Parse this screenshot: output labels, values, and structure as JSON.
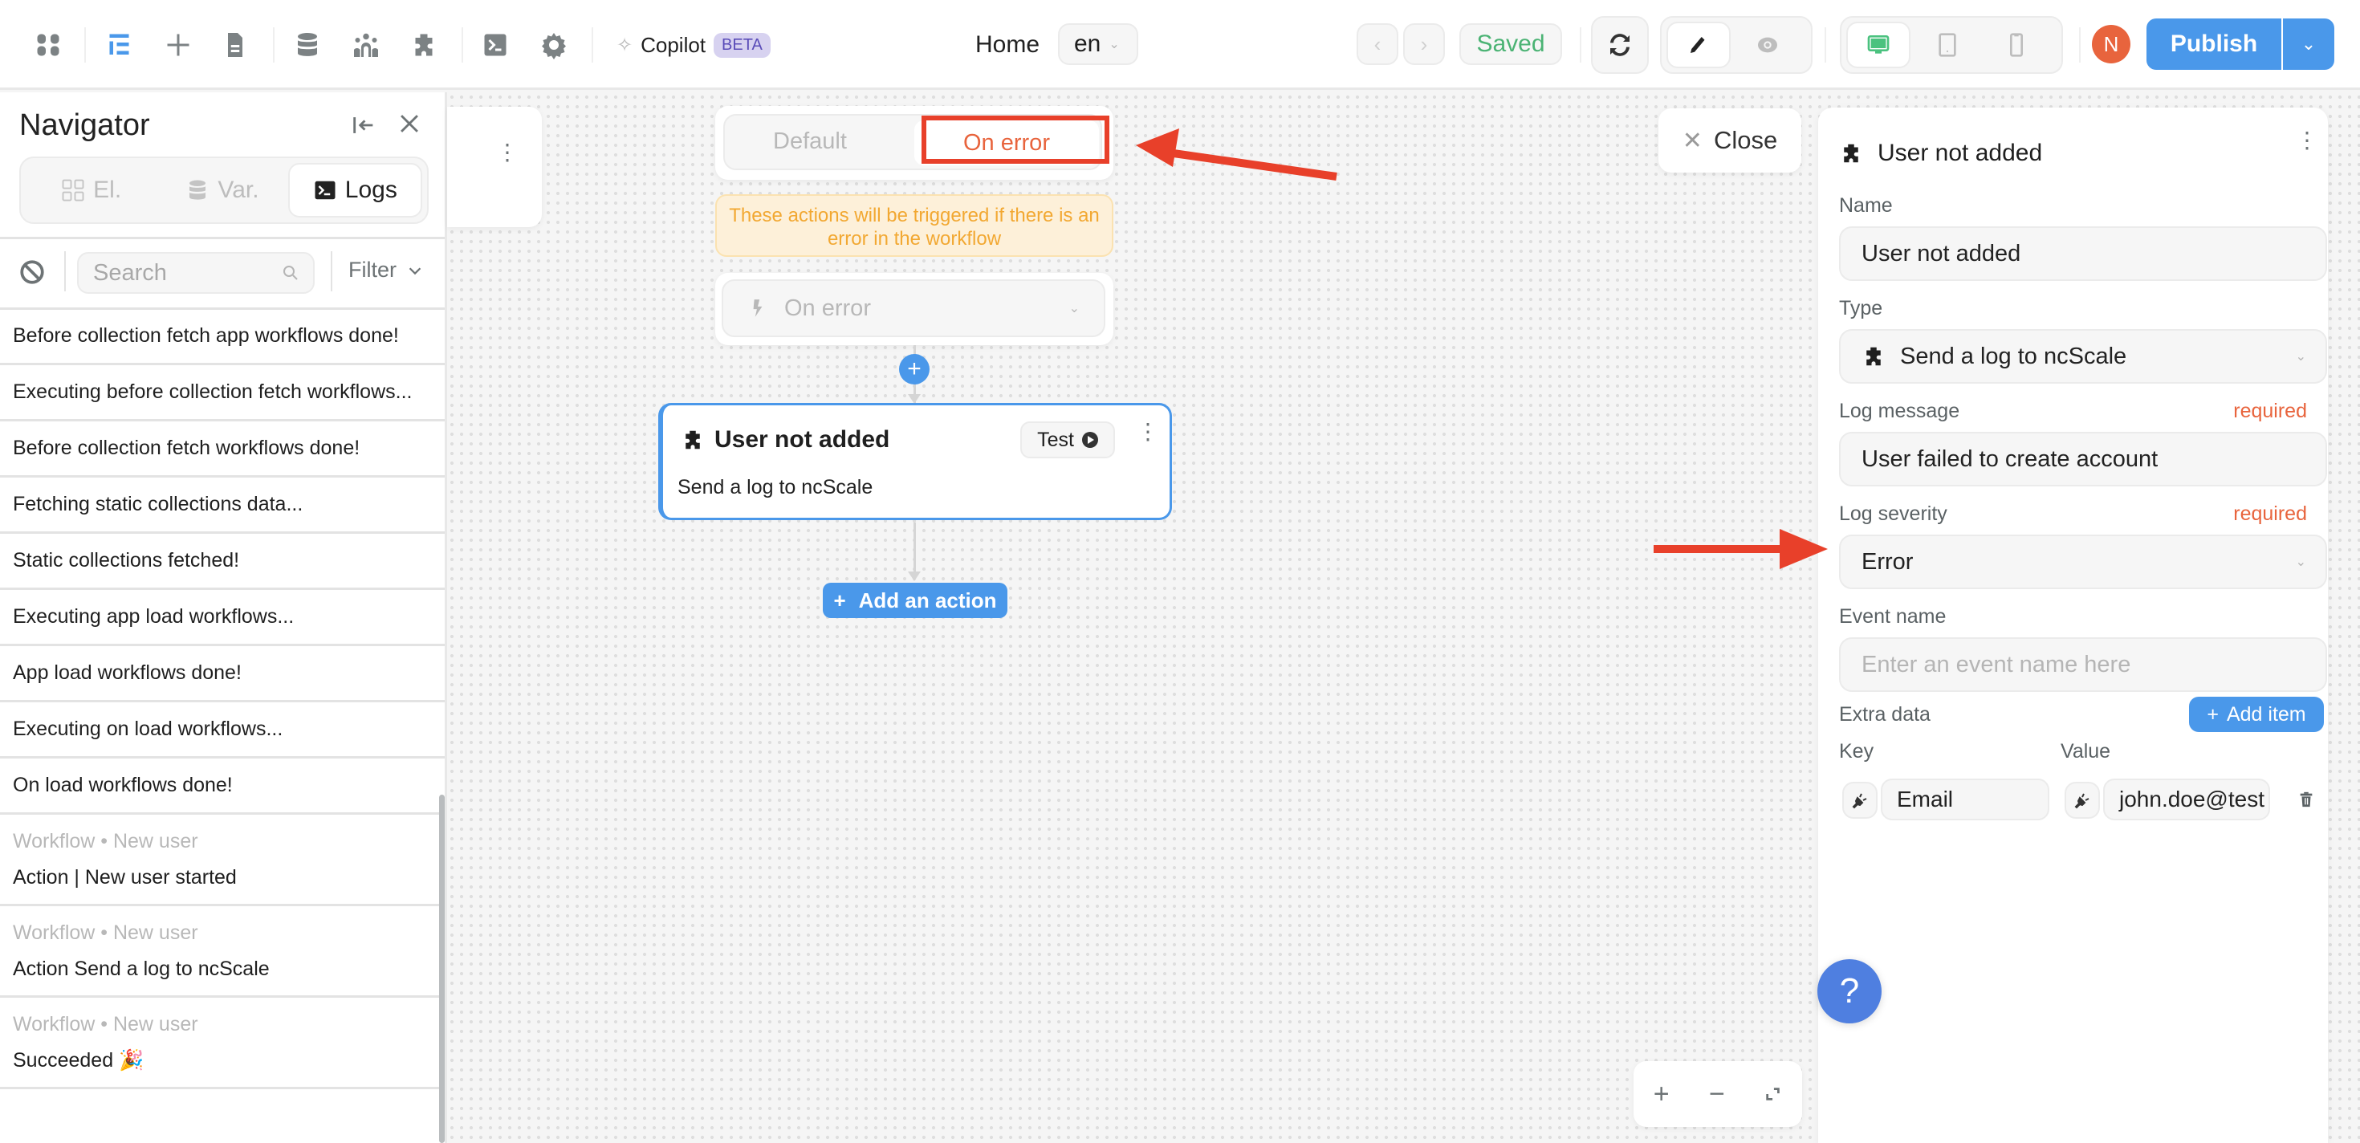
{
  "topbar": {
    "icons": [
      "apps-icon",
      "layers-icon",
      "add-icon",
      "page-icon",
      "database-icon",
      "users-icon",
      "plugin-icon",
      "terminal-icon",
      "gear-icon"
    ],
    "copilot_label": "Copilot",
    "beta_badge": "BETA",
    "page_name": "Home",
    "language": "en",
    "save_status": "Saved",
    "avatar_initial": "N",
    "publish_label": "Publish",
    "colors": {
      "accent": "#4a98ea",
      "saved": "#4bb374",
      "avatar": "#e8643d"
    }
  },
  "navigator": {
    "title": "Navigator",
    "tabs": [
      {
        "label": "El.",
        "icon": "grid-icon",
        "active": false
      },
      {
        "label": "Var.",
        "icon": "database-icon",
        "active": false
      },
      {
        "label": "Logs",
        "icon": "terminal-icon",
        "active": true
      }
    ],
    "search_placeholder": "Search",
    "filter_label": "Filter",
    "logs": [
      {
        "message": "Before collection fetch app workflows done!"
      },
      {
        "message": "Executing before collection fetch workflows..."
      },
      {
        "message": "Before collection fetch workflows done!"
      },
      {
        "message": "Fetching static collections data..."
      },
      {
        "message": "Static collections fetched!"
      },
      {
        "message": "Executing app load workflows..."
      },
      {
        "message": "App load workflows done!"
      },
      {
        "message": "Executing on load workflows..."
      },
      {
        "message": "On load workflows done!"
      },
      {
        "meta": "Workflow • New user",
        "message": "Action | New user started"
      },
      {
        "meta": "Workflow • New user",
        "message": "Action Send a log to ncScale"
      },
      {
        "meta": "Workflow • New user",
        "message": "Succeeded 🎉"
      }
    ]
  },
  "canvas": {
    "segment": {
      "default_label": "Default",
      "on_error_label": "On error",
      "active": "On error"
    },
    "info_text": "These actions will be triggered if there is an error in the workflow",
    "trigger_label": "On error",
    "action_card": {
      "title": "User not added",
      "subtitle": "Send a log to ncScale",
      "test_label": "Test"
    },
    "add_action_label": "Add an action",
    "zoom_controls": {
      "zoom_in": "+",
      "zoom_out": "−",
      "fit": "fit-icon"
    }
  },
  "panel": {
    "close_label": "Close",
    "title": "User not added",
    "name_label": "Name",
    "name_value": "User not added",
    "type_label": "Type",
    "type_value": "Send a log to ncScale",
    "log_message_label": "Log message",
    "log_message_value": "User failed to create account",
    "required_label": "required",
    "log_severity_label": "Log severity",
    "log_severity_value": "Error",
    "event_name_label": "Event name",
    "event_name_placeholder": "Enter an event name here",
    "extra_data_label": "Extra data",
    "add_item_label": "Add item",
    "key_label": "Key",
    "value_label": "Value",
    "extra_items": [
      {
        "key": "Email",
        "value": "john.doe@test"
      }
    ]
  },
  "help_label": "?",
  "annotations": {
    "color": "#e8402a"
  }
}
